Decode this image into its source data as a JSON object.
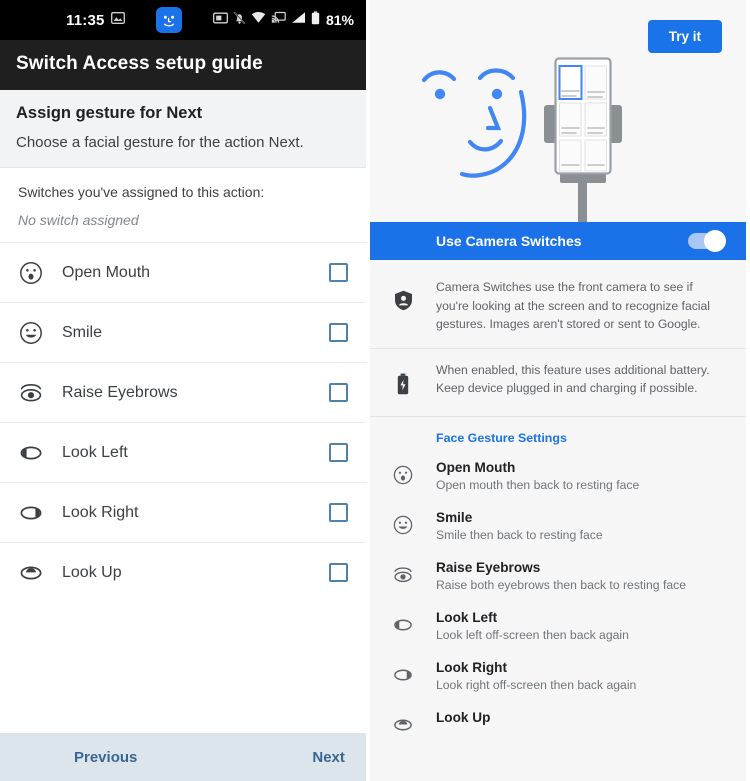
{
  "left": {
    "status_bar": {
      "time": "11:35",
      "battery_percent": "81%",
      "icons": [
        "screenshot-icon",
        "notifications-muted-icon",
        "wifi-icon",
        "cast-icon",
        "signal-icon",
        "battery-icon"
      ],
      "badge_icon": "camera-switches-face-icon"
    },
    "appbar": {
      "title": "Switch Access setup guide"
    },
    "section": {
      "title": "Assign gesture for Next",
      "subtitle": "Choose a facial gesture for the action Next."
    },
    "assigned": {
      "label": "Switches you've assigned to this action:",
      "value": "No switch assigned"
    },
    "gestures": [
      {
        "label": "Open Mouth",
        "icon": "open-mouth-face-icon",
        "checked": false
      },
      {
        "label": "Smile",
        "icon": "smile-face-icon",
        "checked": false
      },
      {
        "label": "Raise Eyebrows",
        "icon": "raise-eyebrows-icon",
        "checked": false
      },
      {
        "label": "Look Left",
        "icon": "look-left-eye-icon",
        "checked": false
      },
      {
        "label": "Look Right",
        "icon": "look-right-eye-icon",
        "checked": false
      },
      {
        "label": "Look Up",
        "icon": "look-up-eye-icon",
        "checked": false
      }
    ],
    "footer": {
      "previous": "Previous",
      "next": "Next"
    }
  },
  "right": {
    "hero": {
      "try_button": "Try it",
      "illustration": "face-and-phone-on-stand-illustration"
    },
    "toggle": {
      "title": "Use Camera Switches",
      "enabled": true
    },
    "info": [
      {
        "icon": "privacy-shield-icon",
        "text": "Camera Switches use the front camera to see if you're looking at the screen and to recognize facial gestures. Images aren't stored or sent to Google."
      },
      {
        "icon": "battery-charging-icon",
        "text": "When enabled, this feature uses additional battery. Keep device plugged in and charging if possible."
      }
    ],
    "face_gesture_title": "Face Gesture Settings",
    "face_gestures": [
      {
        "name": "Open Mouth",
        "desc": "Open mouth then back to resting face",
        "icon": "open-mouth-face-icon"
      },
      {
        "name": "Smile",
        "desc": "Smile then back to resting face",
        "icon": "smile-face-icon"
      },
      {
        "name": "Raise Eyebrows",
        "desc": "Raise both eyebrows then back to resting face",
        "icon": "raise-eyebrows-icon"
      },
      {
        "name": "Look Left",
        "desc": "Look left off-screen then back again",
        "icon": "look-left-eye-icon"
      },
      {
        "name": "Look Right",
        "desc": "Look right off-screen then back again",
        "icon": "look-right-eye-icon"
      },
      {
        "name": "Look Up",
        "desc": "",
        "icon": "look-up-eye-icon"
      }
    ]
  },
  "colors": {
    "accent_blue": "#1a73e8",
    "appbar_black": "#1f1f1f",
    "footer_bg": "#dde5ec",
    "footer_text": "#3b6591",
    "checkbox_border": "#5081a8"
  }
}
